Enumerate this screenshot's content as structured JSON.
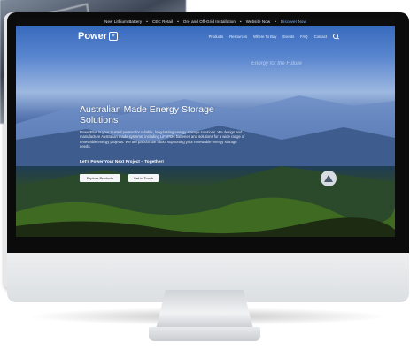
{
  "topbar": {
    "items": [
      {
        "label": "New Lithium Battery"
      },
      {
        "label": "CEC Retail"
      },
      {
        "label": "On- and Off-Grid Installation"
      },
      {
        "label": "Website Now"
      },
      {
        "label": "Discover Now"
      }
    ]
  },
  "brand": {
    "name": "Power",
    "mark": "+"
  },
  "nav": {
    "items": [
      {
        "label": "Products"
      },
      {
        "label": "Resources"
      },
      {
        "label": "Where To Buy"
      },
      {
        "label": "Events"
      },
      {
        "label": "FAQ"
      },
      {
        "label": "Contact"
      }
    ]
  },
  "hero": {
    "tagline": "Energy for the Future",
    "title": "Australian Made Energy Storage Solutions",
    "description": "PowerPlus is your trusted partner for reliable, long-lasting energy storage solutions. We design and manufacture Australian made systems, including LiFePO4 batteries and solutions for a wide range of renewable energy projects. We are passionate about supporting your renewable energy storage needs.",
    "cta_text": "Let's Power Your Next Project – Together!",
    "buttons": [
      {
        "label": "Explore Products"
      },
      {
        "label": "Get in Touch"
      }
    ]
  },
  "colors": {
    "accent": "#7fb6ff",
    "topbar": "#0d0d0d",
    "button": "#f4f6f8"
  }
}
